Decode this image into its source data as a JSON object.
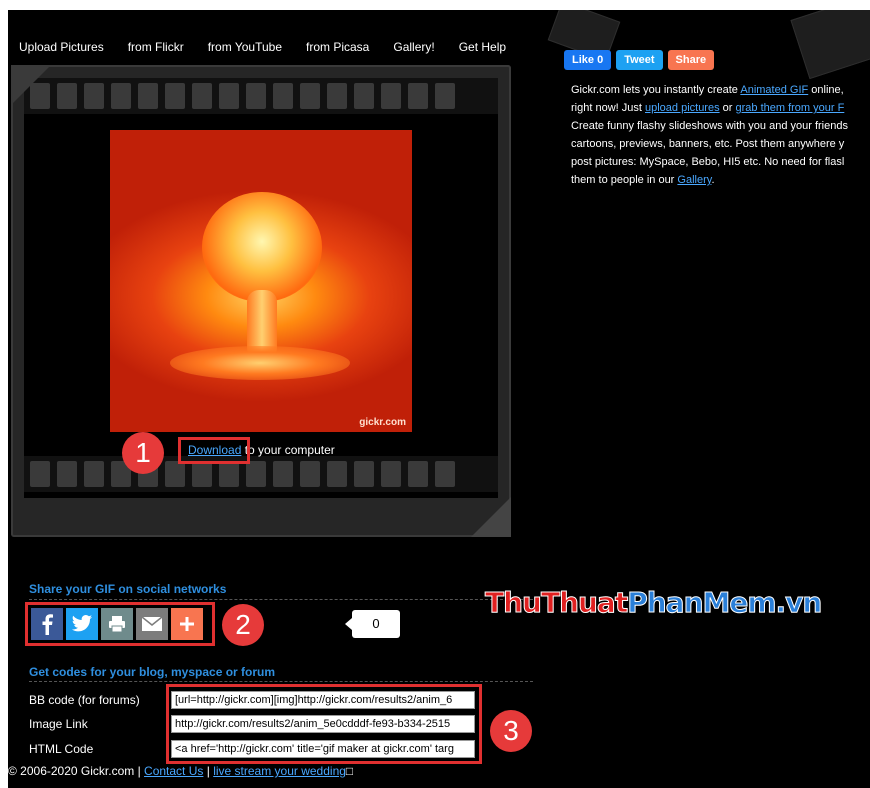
{
  "nav": [
    "Upload Pictures",
    "from Flickr",
    "from YouTube",
    "from Picasa",
    "Gallery!",
    "Get Help"
  ],
  "gif": {
    "watermark": "gickr.com"
  },
  "download": {
    "link": "Download",
    "rest": " to your computer"
  },
  "callouts": [
    "1",
    "2",
    "3"
  ],
  "social_top": {
    "like": "Like 0",
    "tweet": "Tweet",
    "share": "Share"
  },
  "intro": {
    "l1_a": "Gickr.com lets you instantly create ",
    "l1_link": "Animated GIF",
    "l1_b": " online,",
    "l2_a": "right now! Just ",
    "l2_link1": "upload pictures",
    "l2_b": " or ",
    "l2_link2": "grab them from your F",
    "l3": "Create funny flashy slideshows with you and your friends",
    "l4": "cartoons, previews, banners, etc. Post them anywhere y",
    "l5": "post pictures: MySpace, Bebo, HI5 etc. No need for flasl",
    "l6_a": "them to people in our ",
    "l6_link": "Gallery",
    "l6_b": "."
  },
  "share": {
    "heading": "Share your GIF on social networks",
    "icons": [
      "facebook-icon",
      "twitter-icon",
      "print-icon",
      "email-icon",
      "plus-icon"
    ],
    "count": "0"
  },
  "watermark": {
    "part1": "ThuThuat",
    "part2": "PhanMem.vn"
  },
  "codes": {
    "heading": "Get codes for your blog, myspace or forum",
    "rows": [
      {
        "label": "BB code (for forums)",
        "value": "[url=http://gickr.com][img]http://gickr.com/results2/anim_6"
      },
      {
        "label": "Image Link",
        "value": "http://gickr.com/results2/anim_5e0cdddf-fe93-b334-2515"
      },
      {
        "label": "HTML Code",
        "value": "<a href='http://gickr.com' title='gif maker at gickr.com' targ"
      }
    ]
  },
  "footer": {
    "copy": "© 2006-2020 Gickr.com | ",
    "contact": "Contact Us",
    "sep": " | ",
    "live": "live stream your wedding",
    "tail": "□"
  },
  "colors": {
    "accent_blue": "#2f8fdf",
    "link": "#4aa8ff",
    "callout_red": "#e63a3a",
    "facebook": "#3b5998",
    "twitter": "#1da1f2",
    "print": "#6f8b8c",
    "email": "#7c7c7c",
    "plus": "#f87550"
  }
}
